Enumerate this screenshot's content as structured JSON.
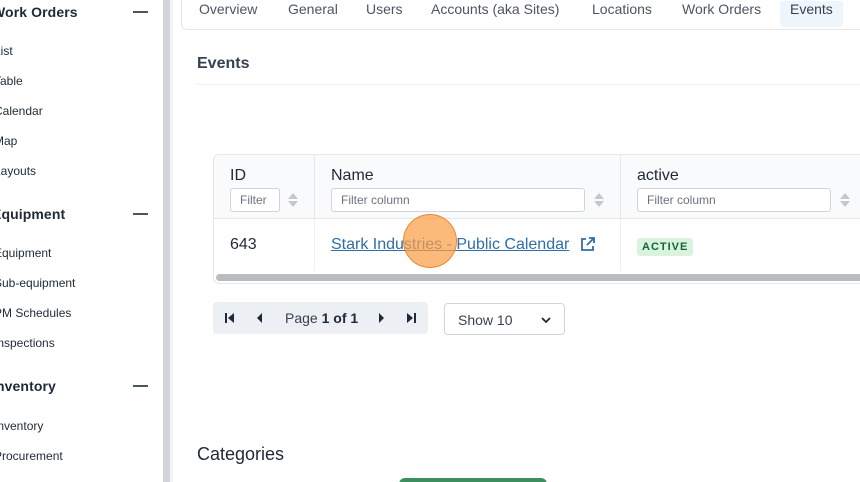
{
  "sidebar": {
    "sections": [
      {
        "title": "Work Orders",
        "items": [
          "List",
          "Table",
          "Calendar",
          "Map",
          "Layouts"
        ]
      },
      {
        "title": "Equipment",
        "items": [
          "Equipment",
          "Sub-equipment",
          "PM Schedules",
          "Inspections"
        ]
      },
      {
        "title": "Inventory",
        "items": [
          "Inventory",
          "Procurement"
        ]
      }
    ]
  },
  "tabs": [
    "Overview",
    "General",
    "Users",
    "Accounts (aka Sites)",
    "Locations",
    "Work Orders",
    "Events"
  ],
  "active_tab": "Events",
  "events_section": {
    "title": "Events"
  },
  "table": {
    "columns": [
      {
        "label": "ID",
        "filter_placeholder": "Filter"
      },
      {
        "label": "Name",
        "filter_placeholder": "Filter column"
      },
      {
        "label": "active",
        "filter_placeholder": "Filter column"
      }
    ],
    "rows": [
      {
        "id": "643",
        "name": "Stark Industries - Public Calendar",
        "status": "ACTIVE"
      }
    ]
  },
  "pagination": {
    "page_prefix": "Page",
    "page_current": "1 of 1",
    "show_label": "Show 10"
  },
  "categories_section": {
    "title": "Categories"
  },
  "colors": {
    "link": "#2f6ea8",
    "badge_bg": "#d9f3df",
    "badge_text": "#166534",
    "active_tab_bg": "#eef5fc",
    "click_indicator": "#f5a04a"
  }
}
